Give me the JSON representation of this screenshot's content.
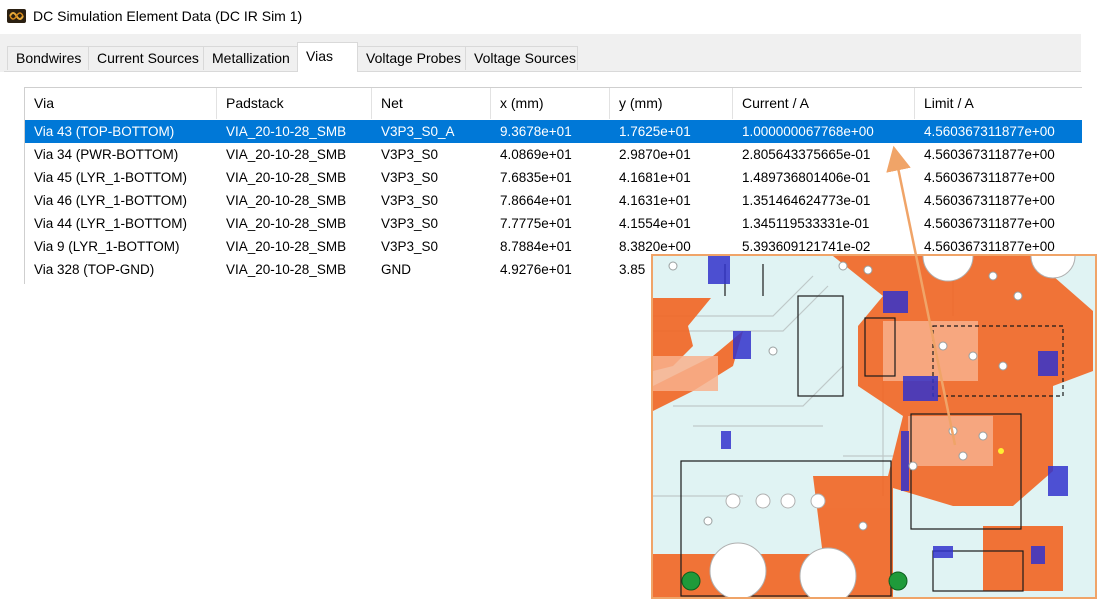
{
  "window": {
    "title": "DC Simulation Element Data (DC IR Sim 1)",
    "icon": "app-icon"
  },
  "tabs": [
    {
      "label": "Bondwires",
      "active": false
    },
    {
      "label": "Current Sources",
      "active": false
    },
    {
      "label": "Metallization",
      "active": false
    },
    {
      "label": "Vias",
      "active": true
    },
    {
      "label": "Voltage Probes",
      "active": false
    },
    {
      "label": "Voltage Sources",
      "active": false
    }
  ],
  "table": {
    "columns": [
      "Via",
      "Padstack",
      "Net",
      "x (mm)",
      "y (mm)",
      "Current / A",
      "Limit / A"
    ],
    "rows": [
      [
        "Via 43 (TOP-BOTTOM)",
        "VIA_20-10-28_SMB",
        "V3P3_S0_A",
        "9.3678e+01",
        "1.7625e+01",
        "1.000000067768e+00",
        "4.560367311877e+00"
      ],
      [
        "Via 34 (PWR-BOTTOM)",
        "VIA_20-10-28_SMB",
        "V3P3_S0",
        "4.0869e+01",
        "2.9870e+01",
        "2.805643375665e-01",
        "4.560367311877e+00"
      ],
      [
        "Via 45 (LYR_1-BOTTOM)",
        "VIA_20-10-28_SMB",
        "V3P3_S0",
        "7.6835e+01",
        "4.1681e+01",
        "1.489736801406e-01",
        "4.560367311877e+00"
      ],
      [
        "Via 46 (LYR_1-BOTTOM)",
        "VIA_20-10-28_SMB",
        "V3P3_S0",
        "7.8664e+01",
        "4.1631e+01",
        "1.351464624773e-01",
        "4.560367311877e+00"
      ],
      [
        "Via 44 (LYR_1-BOTTOM)",
        "VIA_20-10-28_SMB",
        "V3P3_S0",
        "7.7775e+01",
        "4.1554e+01",
        "1.345119533331e-01",
        "4.560367311877e+00"
      ],
      [
        "Via 9 (LYR_1-BOTTOM)",
        "VIA_20-10-28_SMB",
        "V3P3_S0",
        "8.7884e+01",
        "8.3820e+00",
        "5.393609121741e-02",
        "4.560367311877e+00"
      ],
      [
        "Via 328 (TOP-GND)",
        "VIA_20-10-28_SMB",
        "GND",
        "4.9276e+01",
        "3.85",
        "",
        ""
      ]
    ],
    "selected_row": 0
  },
  "colors": {
    "selection": "#0078d7",
    "inset_border": "#f0a468",
    "copper": "#f26522",
    "arrow": "#f0a468"
  }
}
